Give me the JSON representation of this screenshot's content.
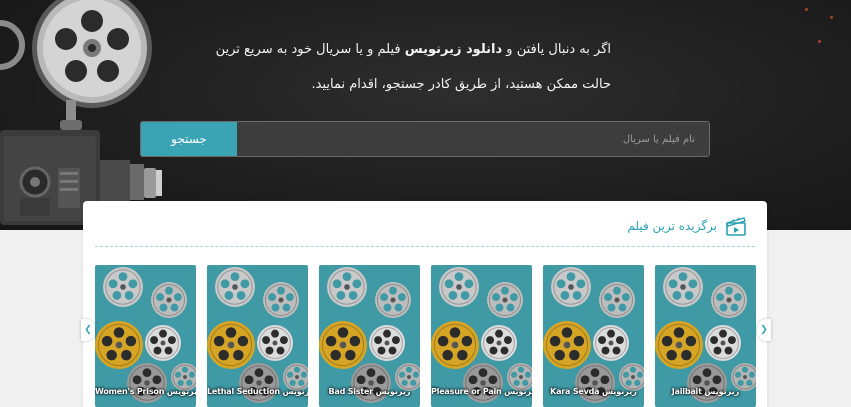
{
  "hero": {
    "line1_prefix": "اگر به دنبال یافتن و",
    "line1_bold": "دانلود زیرنویس",
    "line1_suffix": "فیلم و یا سریال خود به سریع ترین",
    "line2": "حالت ممکن هستید، از طریق کادر جستجو، اقدام نمایید."
  },
  "search": {
    "placeholder": "نام فیلم یا سریال",
    "button_label": "جستجو"
  },
  "featured": {
    "title": "برگزیده ترین فیلم",
    "cards": [
      {
        "label": "Women's Prison زیرنویس"
      },
      {
        "label": "Lethal Seduction زیرنویس"
      },
      {
        "label": "Bad Sister زیرنویس"
      },
      {
        "label": "Pleasure or Pain زیرنویس"
      },
      {
        "label": "Kara Sevda زیرنویس"
      },
      {
        "label": "Jailbait زیرنویس"
      }
    ]
  },
  "nav": {
    "prev_icon": "chevron-left-icon",
    "next_icon": "chevron-right-icon"
  },
  "colors": {
    "accent": "#3aa3b4",
    "hero_bg": "#1f1f1f",
    "card_bg": "#3f9aa6",
    "reel_gold": "#d6a526"
  }
}
